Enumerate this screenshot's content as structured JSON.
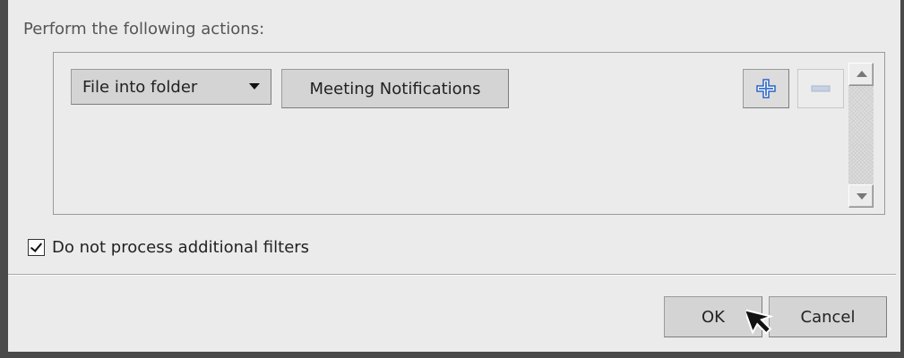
{
  "section": {
    "label": "Perform the following actions:"
  },
  "action_row": {
    "action_select_value": "File into folder",
    "folder_button_label": "Meeting Notifications",
    "add_icon": "plus-icon",
    "remove_icon": "minus-icon"
  },
  "options": {
    "stop_processing_label": "Do not process additional filters",
    "stop_processing_checked": true
  },
  "footer": {
    "ok_label": "OK",
    "cancel_label": "Cancel"
  },
  "colors": {
    "frame": "#4a4a4a",
    "dialog_bg": "#ebebeb",
    "button_bg": "#d4d4d4",
    "add_icon_blue": "#4a7fd4",
    "remove_icon_gray": "#a9b7cc"
  }
}
